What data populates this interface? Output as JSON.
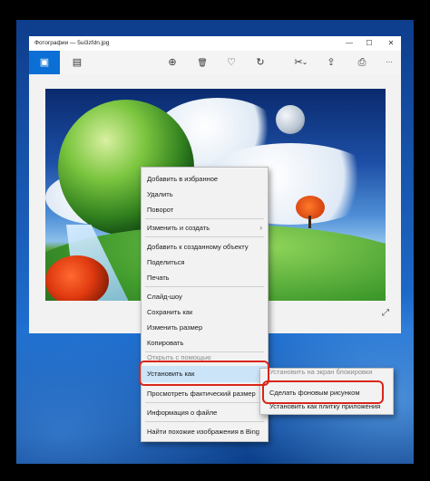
{
  "window": {
    "title": "Фотографии — 5ui3zfdn.jpg",
    "controls": {
      "minimize": "—",
      "maximize": "☐",
      "close": "✕"
    }
  },
  "toolbar": {
    "icons": [
      "photo-icon",
      "info-icon",
      "zoom-icon",
      "delete-icon",
      "favorite-icon",
      "rotate-icon",
      "edit-icon",
      "share-icon",
      "print-icon",
      "more-icon"
    ],
    "glyphs": {
      "photo": "▣",
      "info": "▤",
      "zoom": "⊕",
      "delete": "🗑",
      "favorite": "♡",
      "rotate": "↻",
      "edit": "✂",
      "edit_chevron": "⌄",
      "share": "⇪",
      "print": "⎙",
      "more": "···"
    },
    "accent": "#0b6fd6"
  },
  "photo": {
    "expand_glyph": "⤢"
  },
  "context_menu": {
    "items": [
      {
        "label": "Добавить в избранное"
      },
      {
        "label": "Удалить"
      },
      {
        "label": "Поворот"
      },
      {
        "label": "Изменить и создать",
        "arrow": "›"
      },
      {
        "label": "Добавить к созданному объекту"
      },
      {
        "label": "Поделиться"
      },
      {
        "label": "Печать"
      },
      {
        "label": "Слайд-шоу"
      },
      {
        "label": "Сохранить как"
      },
      {
        "label": "Изменить размер"
      },
      {
        "label": "Копировать"
      },
      {
        "label": "Открыть с помощью"
      },
      {
        "label": "Установить как",
        "arrow": "›"
      },
      {
        "label": "Просмотреть фактический размер"
      },
      {
        "label": "Информация о файле"
      },
      {
        "label": "Найти похожие изображения в Bing"
      }
    ],
    "highlight_color": "#d9251a"
  },
  "submenu": {
    "items": [
      {
        "label": "Установить на экран блокировки"
      },
      {
        "label": "Сделать фоновым рисунком"
      },
      {
        "label": "Установить как плитку приложения"
      }
    ]
  }
}
